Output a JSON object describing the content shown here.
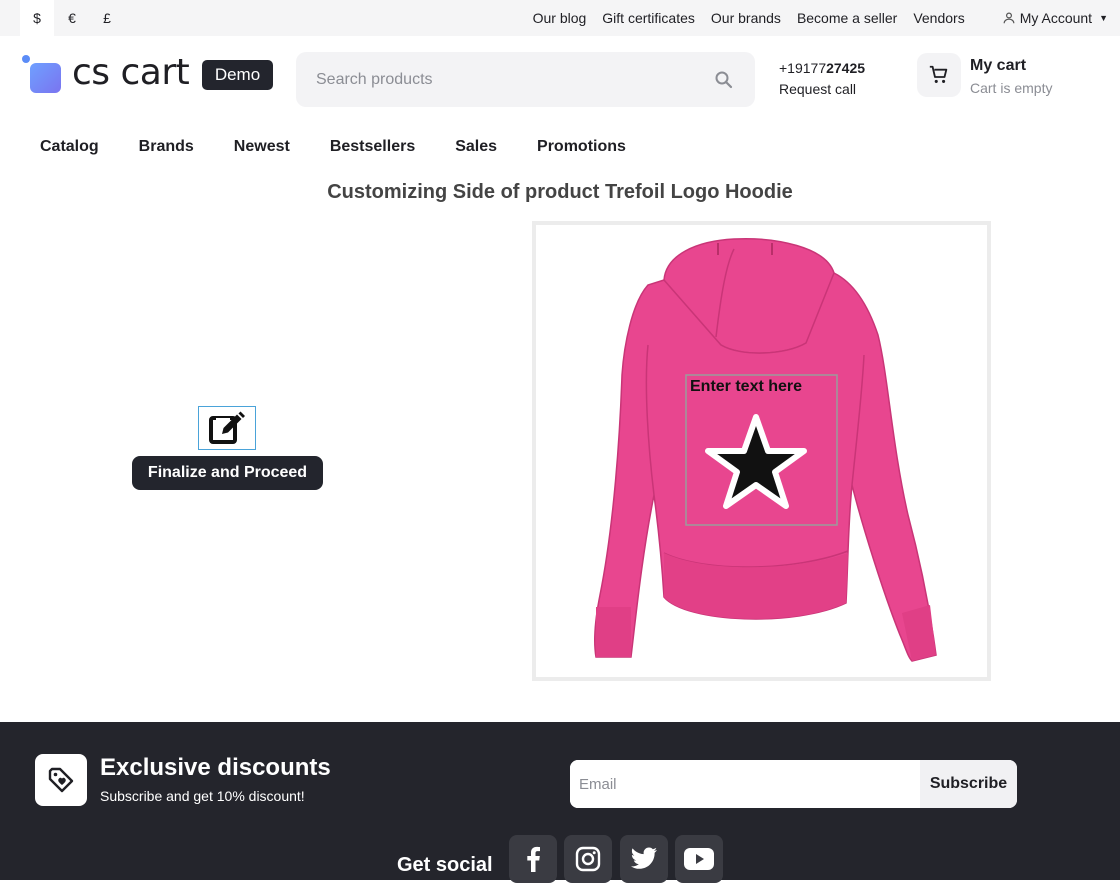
{
  "topbar": {
    "currencies": [
      "$",
      "€",
      "£"
    ],
    "links": [
      "Our blog",
      "Gift certificates",
      "Our brands",
      "Become a seller",
      "Vendors"
    ],
    "account_label": "My Account"
  },
  "header": {
    "logo_text": "cs cart",
    "demo_badge": "Demo",
    "search_placeholder": "Search products",
    "phone_prefix": "+19177",
    "phone_bold": "27425",
    "request_call": "Request call",
    "cart_title": "My cart",
    "cart_status": "Cart is empty"
  },
  "nav": [
    "Catalog",
    "Brands",
    "Newest",
    "Bestsellers",
    "Sales",
    "Promotions"
  ],
  "main": {
    "title": "Customizing Side of product Trefoil Logo Hoodie",
    "finalize_button": "Finalize and Proceed",
    "canvas_text": "Enter text here",
    "product_color": "#e8468f"
  },
  "footer": {
    "discount_title": "Exclusive discounts",
    "discount_sub": "Subscribe and get 10% discount!",
    "email_placeholder": "Email",
    "subscribe_label": "Subscribe",
    "get_social": "Get social",
    "social_icons": [
      "facebook-icon",
      "instagram-icon",
      "twitter-icon",
      "youtube-icon"
    ]
  }
}
